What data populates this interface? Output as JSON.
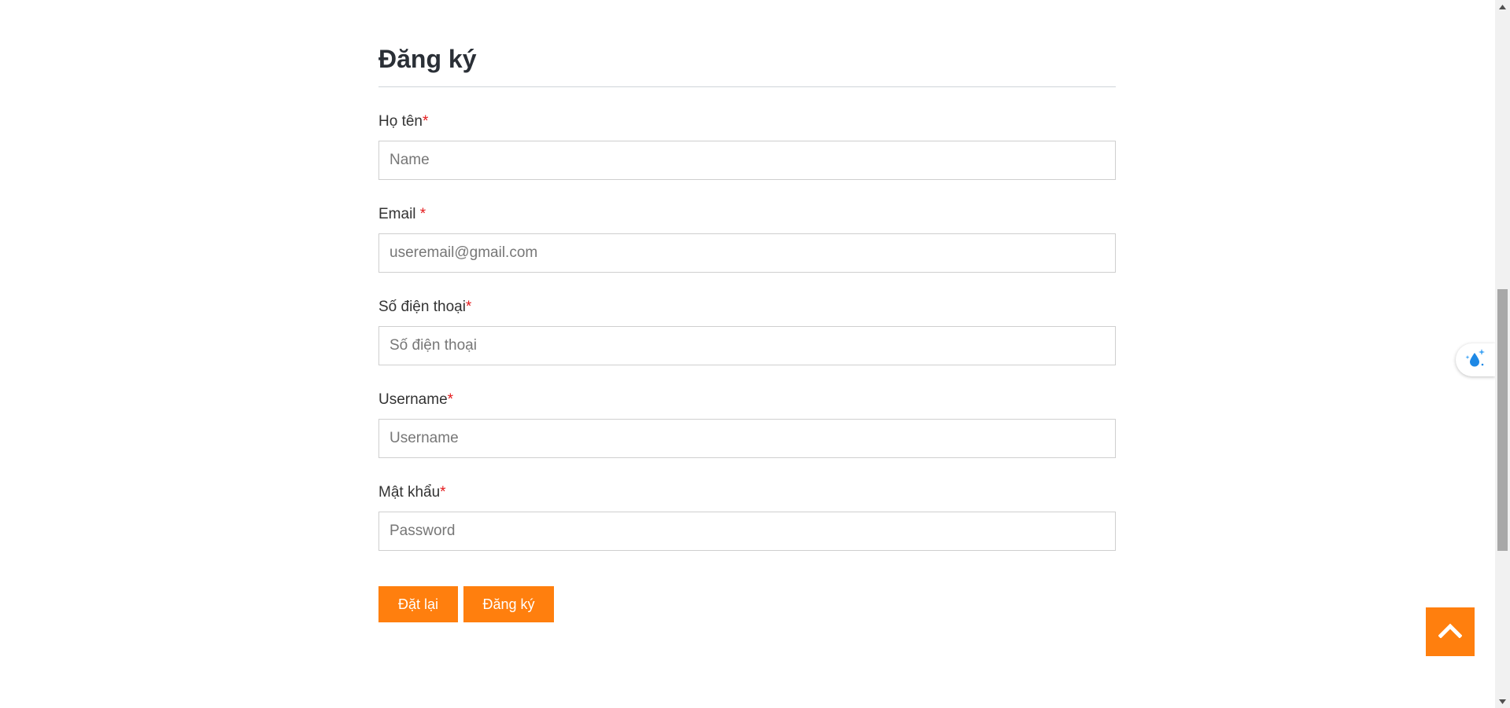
{
  "form": {
    "title": "Đăng ký",
    "fields": [
      {
        "label": "Họ tên",
        "required_mark": "*",
        "placeholder": "Name",
        "value": ""
      },
      {
        "label": "Email ",
        "required_mark": "*",
        "placeholder": "useremail@gmail.com",
        "value": ""
      },
      {
        "label": "Số điện thoại",
        "required_mark": "*",
        "placeholder": "Số điện thoại",
        "value": ""
      },
      {
        "label": "Username",
        "required_mark": "*",
        "placeholder": "Username",
        "value": ""
      },
      {
        "label": "Mật khẩu",
        "required_mark": "*",
        "placeholder": "Password",
        "value": ""
      }
    ],
    "reset_label": "Đặt lại",
    "submit_label": "Đăng ký"
  },
  "colors": {
    "accent": "#ff7f0e",
    "required": "#e4191b"
  },
  "icons": {
    "scroll_top": "chevron-up-icon",
    "floating_tool": "water-drop-sparkle-icon"
  }
}
